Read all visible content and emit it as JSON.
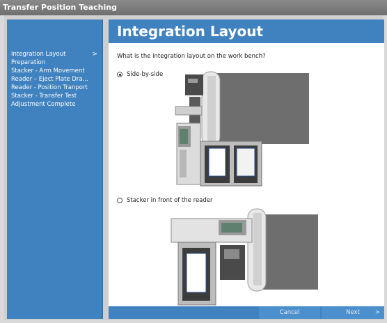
{
  "window": {
    "title": "Transfer Position Teaching"
  },
  "sidebar": {
    "items": [
      {
        "label": "Integration Layout",
        "active": true,
        "arrow": ">"
      },
      {
        "label": "Preparation"
      },
      {
        "label": "Stacker - Arm Movement"
      },
      {
        "label": "Reader – Eject Plate Dra..."
      },
      {
        "label": "Reader - Position Tranport"
      },
      {
        "label": "Stacker - Transfer Test"
      },
      {
        "label": "Adjustment Complete"
      }
    ]
  },
  "main": {
    "title": "Integration Layout",
    "question": "What is the integration layout on the work bench?",
    "options": [
      {
        "label": "Side-by-side",
        "selected": true
      },
      {
        "label": "Stacker in front of the reader",
        "selected": false
      }
    ]
  },
  "footer": {
    "cancel_label": "Cancel",
    "next_label": "Next",
    "next_chevron": ">"
  },
  "colors": {
    "accent": "#3f82bf",
    "title_bar": "#7a7a7a",
    "device_dark": "#6e6e6e",
    "device_light": "#e6e6e6"
  }
}
